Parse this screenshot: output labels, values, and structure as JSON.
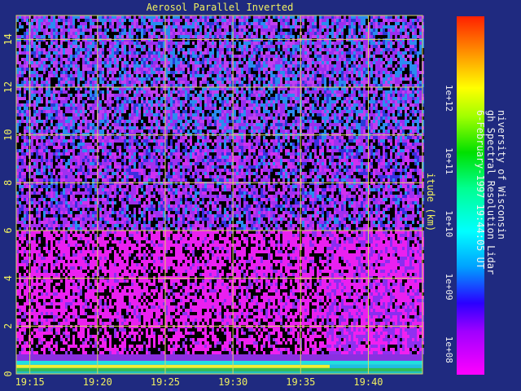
{
  "chart_data": {
    "type": "heatmap",
    "title": "Aerosol Parallel Inverted",
    "ylabel": "itude (km)",
    "x_ticks": [
      "19:15",
      "19:20",
      "19:25",
      "19:30",
      "19:35",
      "19:40"
    ],
    "y_ticks": [
      "0",
      "2",
      "4",
      "6",
      "8",
      "10",
      "12",
      "14"
    ],
    "ylim": [
      0,
      15
    ],
    "xlim": [
      "19:14",
      "19:44"
    ],
    "grid": true,
    "colorbar": {
      "scale": "log",
      "tick_labels": [
        "1e+12",
        "1e+11",
        "1e+10",
        "1e+09",
        "1e+08"
      ],
      "tick_values": [
        1000000000000.0,
        100000000000.0,
        10000000000.0,
        1000000000.0,
        100000000.0
      ],
      "range": [
        40000000.0,
        20000000000000.0
      ]
    },
    "colors": {
      "background": "#1f2a80",
      "grid": "#d8d860",
      "text": "#f0f060"
    }
  },
  "meta_text": {
    "line1": "niversity of Wisconsin",
    "line2": "gh Spectral Resolution Lidar",
    "line3": "6-February-1997 19:44:05 UT"
  }
}
